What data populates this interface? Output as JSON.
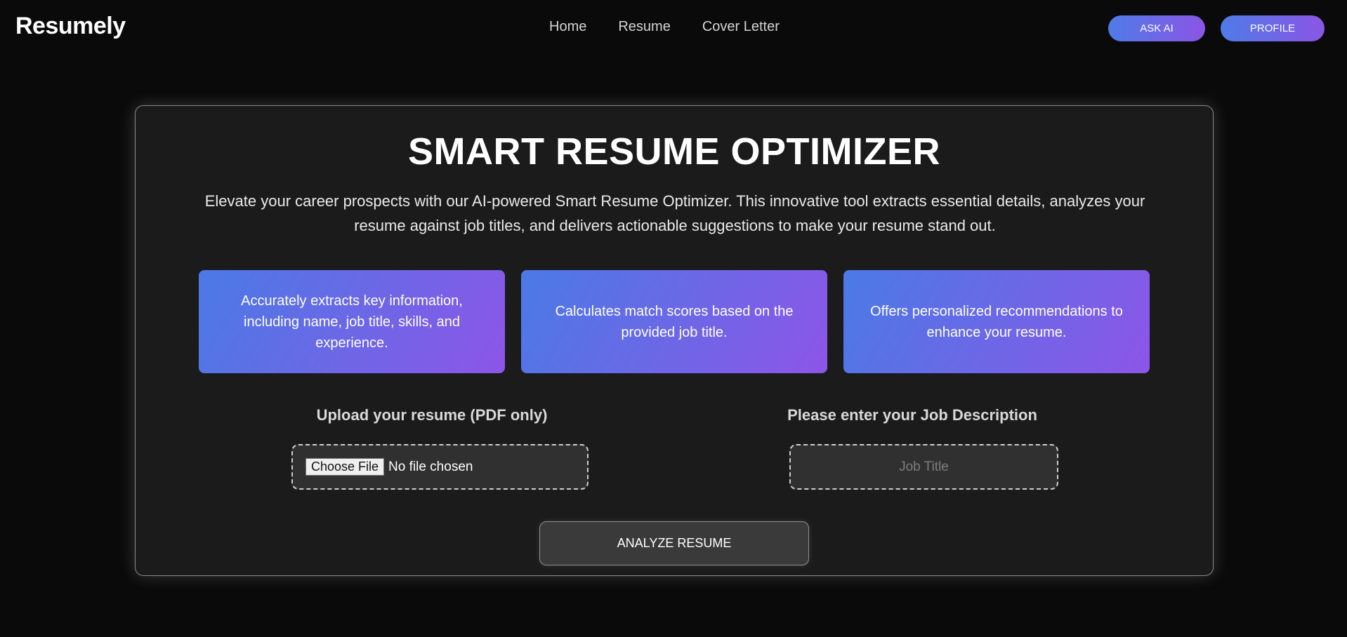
{
  "brand": {
    "logo": "Resumely"
  },
  "nav": {
    "links": [
      "Home",
      "Resume",
      "Cover Letter"
    ],
    "ask_ai": "ASK AI",
    "profile": "PROFILE"
  },
  "main": {
    "title": "SMART RESUME OPTIMIZER",
    "subtitle": "Elevate your career prospects with our AI-powered Smart Resume Optimizer. This innovative tool extracts essential details, analyzes your resume against job titles, and delivers actionable suggestions to make your resume stand out.",
    "features": [
      "Accurately extracts key information, including name, job title, skills, and experience.",
      "Calculates match scores based on the provided job title.",
      "Offers personalized recommendations to enhance your resume."
    ],
    "upload_label": "Upload your resume (PDF only)",
    "choose_file": "Choose File",
    "no_file": "No file chosen",
    "job_label": "Please enter your Job Description",
    "job_placeholder": "Job Title",
    "analyze": "ANALYZE RESUME"
  },
  "colors": {
    "background": "#0a0a0a",
    "card": "#1b1b1b",
    "gradient_start": "#4f7be8",
    "gradient_end": "#8b55e6"
  }
}
